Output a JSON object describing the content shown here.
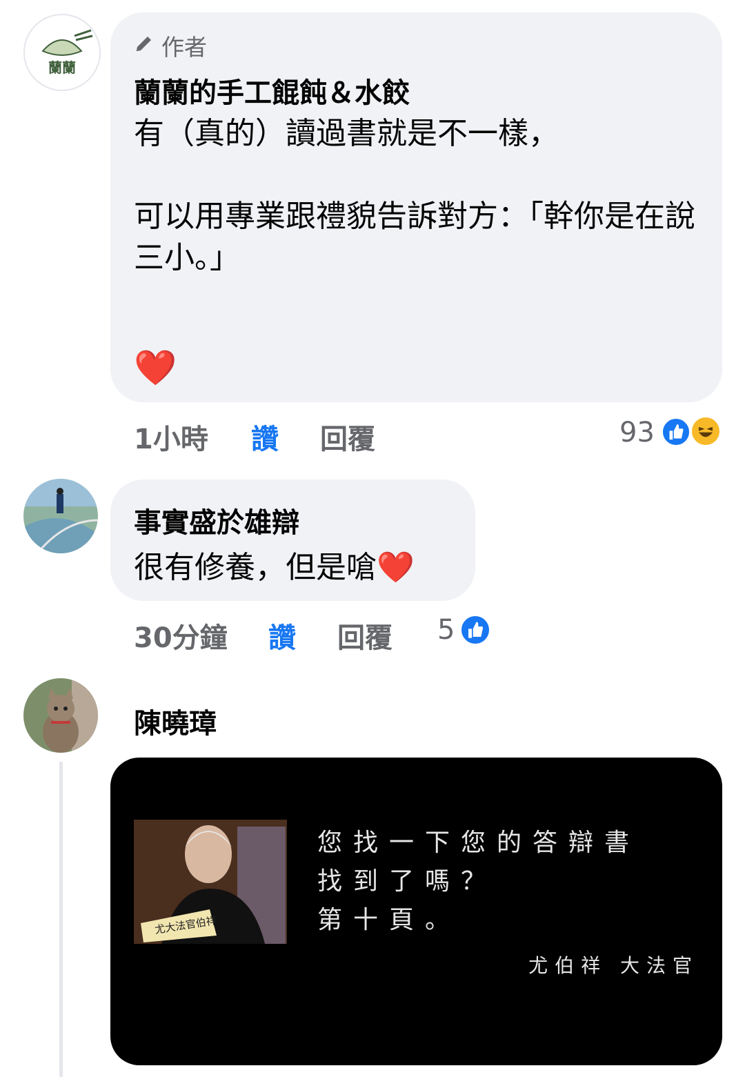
{
  "comments": [
    {
      "badge": "作者",
      "author": "蘭蘭的手工餛飩＆水餃",
      "avatar_text": "蘭蘭",
      "text": "有（真的）讀過書就是不一樣，\n\n可以用專業跟禮貌告訴對方：「幹你是在說三小。」",
      "emoji": "❤️",
      "time": "1小時",
      "like_label": "讚",
      "reply_label": "回覆",
      "reaction_count": "93",
      "reactions": [
        "like-icon",
        "haha-icon"
      ]
    },
    {
      "author": "事實盛於雄辯",
      "text": "很有修養，但是嗆",
      "emoji": "❤️",
      "time": "30分鐘",
      "like_label": "讚",
      "reply_label": "回覆",
      "reaction_count": "5",
      "reactions": [
        "like-icon"
      ]
    },
    {
      "author": "陳曉璋",
      "meme": {
        "lines": [
          "您找一下您的答辯書",
          "找到了嗎？",
          "第十頁。"
        ],
        "signature": "尤伯祥 大法官",
        "nameplate": "尤大法官伯祥"
      }
    }
  ],
  "colors": {
    "accent": "#1877f2",
    "bubble": "#f0f2f5",
    "muted": "#65676b"
  }
}
